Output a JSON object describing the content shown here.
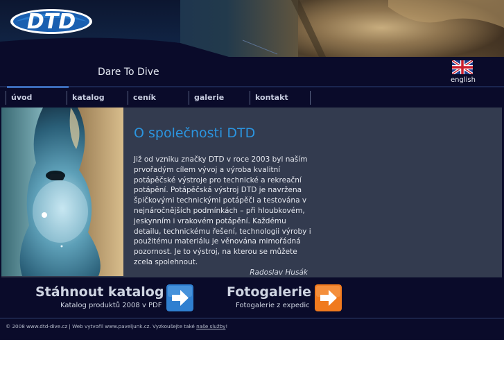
{
  "brand": {
    "logo_text": "DTD",
    "tagline": "Dare To Dive"
  },
  "language": {
    "label": "english",
    "icon": "uk-flag-icon"
  },
  "nav": {
    "items": [
      {
        "label": "úvod",
        "active": true
      },
      {
        "label": "katalog",
        "active": false
      },
      {
        "label": "ceník",
        "active": false
      },
      {
        "label": "galerie",
        "active": false
      },
      {
        "label": "kontakt",
        "active": false
      }
    ]
  },
  "main": {
    "title": "O společnosti DTD",
    "paragraph_lines": [
      "Již od vzniku značky DTD v roce 2003 byl naším",
      "prvořadým cílem vývoj a výroba kvalitní",
      "potápěčské výstroje pro technické a rekreační",
      "potápění. Potápěčská výstroj DTD je navržena",
      "špičkovými technickými potápěči a testována v",
      "nejnáročnějších podmínkách – při hloubkovém,",
      "jeskynním i vrakovém potápění. Každému",
      "detailu, technickému řešení, technologii výroby i",
      "použitému materiálu je věnována mimořádná",
      "pozornost. Je to výstroj, na kterou se můžete",
      "zcela spolehnout."
    ],
    "signature": "Radoslav Husák"
  },
  "promos": [
    {
      "title": "Stáhnout katalog",
      "subtitle": "Katalog produktů 2008 v PDF",
      "button_icon": "arrow-right-icon",
      "button_color": "#2f7fd0"
    },
    {
      "title": "Fotogalerie",
      "subtitle": "Fotogalerie z expedic",
      "button_icon": "arrow-right-icon",
      "button_color": "#f07a1e"
    }
  ],
  "footer": {
    "text": "© 2008 www.dtd-dive.cz | Web vytvořil www.paveljunk.cz. Vyzkoušejte také ",
    "link": "naše služby",
    "suffix": "!"
  },
  "colors": {
    "background": "#0a0b2a",
    "panel": "#333b4f",
    "accent_blue": "#2b95e0",
    "nav_active": "#3b6bb8"
  }
}
